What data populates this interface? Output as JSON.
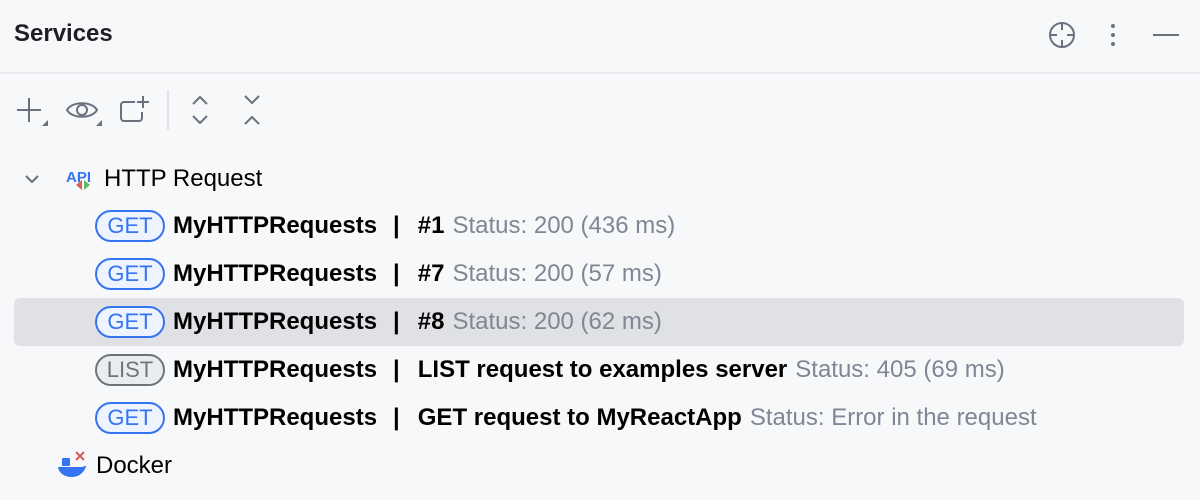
{
  "header": {
    "title": "Services"
  },
  "toolbar": {
    "items": [
      "add-icon",
      "eye-icon",
      "new-group-icon",
      "expand-all-icon",
      "collapse-all-icon"
    ]
  },
  "tree": {
    "http_label": "HTTP Request",
    "separator": "|",
    "requests": [
      {
        "method": "GET",
        "name": "MyHTTPRequests",
        "title": "#1",
        "status": "Status: 200 (436 ms)"
      },
      {
        "method": "GET",
        "name": "MyHTTPRequests",
        "title": "#7",
        "status": "Status: 200 (57 ms)"
      },
      {
        "method": "GET",
        "name": "MyHTTPRequests",
        "title": "#8",
        "status": "Status: 200 (62 ms)",
        "selected": true
      },
      {
        "method": "LIST",
        "name": "MyHTTPRequests",
        "title": "LIST request to examples server",
        "status": "Status: 405 (69 ms)"
      },
      {
        "method": "GET",
        "name": "MyHTTPRequests",
        "title": "GET request to MyReactApp",
        "status": "Status: Error in the request"
      }
    ],
    "docker_label": "Docker"
  },
  "colors": {
    "accent": "#3574f0",
    "muted": "#818594",
    "selection": "#dfe1e5"
  }
}
